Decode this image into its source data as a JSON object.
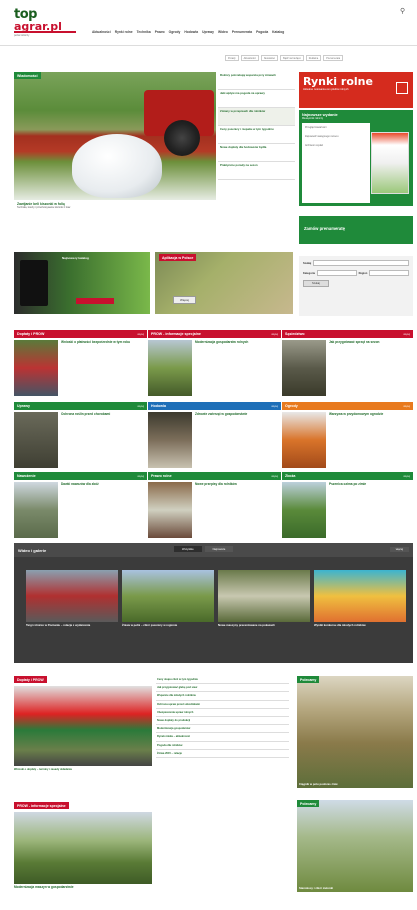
{
  "header": {
    "logo_top": "top",
    "logo_mid": "agrar",
    "logo_suffix": ".pl",
    "logo_tagline": "portal rolniczy",
    "nav": [
      "Aktualności",
      "Rynki rolne",
      "Technika",
      "Prawo",
      "Ogrody",
      "Hodowla",
      "Uprawy",
      "Wideo",
      "Prenumerata",
      "Pogoda",
      "Katalog"
    ],
    "util": [
      "Porady",
      "Aktualności",
      "Newsletter",
      "Bądź na bieżąco",
      "Reklama",
      "Prenumerata"
    ],
    "colors": {
      "brand_green": "#1a5e1f",
      "accent_red": "#c8102e"
    }
  },
  "hero": {
    "badge": "Wiadomości",
    "title": "Zawijanie beli kiszonki w folię",
    "desc": "Technika, koszty i przechowywanie kiszonki z traw",
    "side_items": [
      "Rolnicy potrzebują wsparcia przy żniwach",
      "Jaki wpływ ma pogoda na uprawy",
      "Zmiany w przepisach dla rolników",
      "Ceny pszenicy i rzepaku w tym tygodniu",
      "Nowe dopłaty dla hodowców bydła",
      "Praktyczne porady na sezon"
    ]
  },
  "rynki": {
    "title": "Rynki rolne",
    "subtitle": "Aktualne notowania cen płodów rolnych"
  },
  "magazine": {
    "title": "Najnowsze wydanie",
    "subtitle": "Miesięcznik rolniczy",
    "items": [
      "Przegląd zawartości",
      "Zapowiedź następnego numeru",
      "Archiwum wydań"
    ]
  },
  "subscribe": "Zamów prenumeratę",
  "search": {
    "label_query": "Szukaj",
    "label_cat": "Kategoria",
    "label_region": "Region",
    "button": "Szukaj"
  },
  "promo": {
    "left_caption": "Najnowszy katalog",
    "right_caption": "Aplikacja w Polsce",
    "right_button": "Więcej"
  },
  "grid": [
    {
      "head": "Dopłaty i PROW",
      "title": "Wnioski o płatności bezpośrednie w tym roku",
      "color": "#c8102e"
    },
    {
      "head": "PROW - informacje specjalne",
      "title": "Modernizacja gospodarstw rolnych",
      "color": "#c8102e"
    },
    {
      "head": "Sąsiedztwo",
      "title": "Jak przygotować sprzęt na sezon",
      "color": "#c8102e"
    },
    {
      "head": "Uprawy",
      "title": "Ochrona roślin przed chorobami",
      "color": "#1f8a3a"
    },
    {
      "head": "Hodowla",
      "title": "Zdrowie zwierząt w gospodarstwie",
      "color": "#1e6fb8"
    },
    {
      "head": "Ogrody",
      "title": "Warzywa w przydomowym ogrodzie",
      "color": "#e87a1e"
    },
    {
      "head": "Nawożenie",
      "title": "Dawki nawozów dla zbóż",
      "color": "#1f8a3a"
    },
    {
      "head": "Prawo rolne",
      "title": "Nowe przepisy dla rolników",
      "color": "#1f8a3a"
    },
    {
      "head": "Zboża",
      "title": "Pszenica ozima po zimie",
      "color": "#1f8a3a"
    }
  ],
  "grid_more": "więcej",
  "video": {
    "head": "Wideo i galerie",
    "tabs": [
      "Wszystkie",
      "Najnowsze"
    ],
    "more": "więcej",
    "items": [
      "Targi rolnicze w Poznaniu – relacja z wydarzenia",
      "Żniwa w pełni – zbiór pszenicy w regionie",
      "Nowe maszyny prezentowane na pokazach",
      "Wyniki konkursu dla młodych rolników"
    ]
  },
  "bottom": {
    "left_badge": "Dopłaty i PROW",
    "left_caption": "Wnioski o dopłaty – terminy i zasady składania",
    "mid_items": [
      "Ceny skupu zbóż w tym tygodniu",
      "Jak przygotować glebę pod siew",
      "Wsparcie dla młodych rolników",
      "Ochrona upraw przed szkodnikami",
      "Ubezpieczenia upraw rolnych",
      "Nowe dopłaty do produkcji",
      "Modernizacja gospodarstw",
      "Rynek mleka – aktualności",
      "Pogoda dla rolników",
      "Żniwa 2015 – relacje"
    ],
    "right_badge": "Polecamy",
    "right_caption": "Ciągnik w polu podczas żniw",
    "left2_badge": "PROW - informacje specjalne",
    "left2_caption": "Modernizacja maszyn w gospodarstwie",
    "right2_badge": "Polecamy",
    "right2_caption": "Sianokosy i zbiór zielonki"
  }
}
